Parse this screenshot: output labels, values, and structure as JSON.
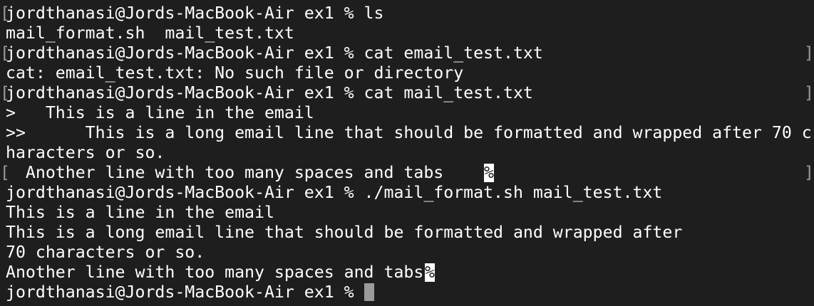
{
  "terminal": {
    "lines": [
      "jordthanasi@Jords-MacBook-Air ex1 % ls",
      "mail_format.sh  mail_test.txt",
      "jordthanasi@Jords-MacBook-Air ex1 % cat email_test.txt",
      "cat: email_test.txt: No such file or directory",
      "jordthanasi@Jords-MacBook-Air ex1 % cat mail_test.txt",
      ">   This is a line in the email",
      ">>      This is a long email line that should be formatted and wrapped after 70 c",
      "haracters or so.",
      "  Another line with too many spaces and tabs   ",
      "jordthanasi@Jords-MacBook-Air ex1 % ./mail_format.sh mail_test.txt",
      "This is a line in the email",
      "This is a long email line that should be formatted and wrapped after",
      "70 characters or so.",
      "Another line with too many spaces and tabs",
      "jordthanasi@Jords-MacBook-Air ex1 % "
    ],
    "no_newline_marker": "%",
    "left_bracket": "[",
    "right_bracket": "]"
  },
  "colors": {
    "background": "#1e1e1e",
    "text": "#ffffff",
    "cursor": "#9a9a9a",
    "bracket": "#9a9a9a"
  }
}
